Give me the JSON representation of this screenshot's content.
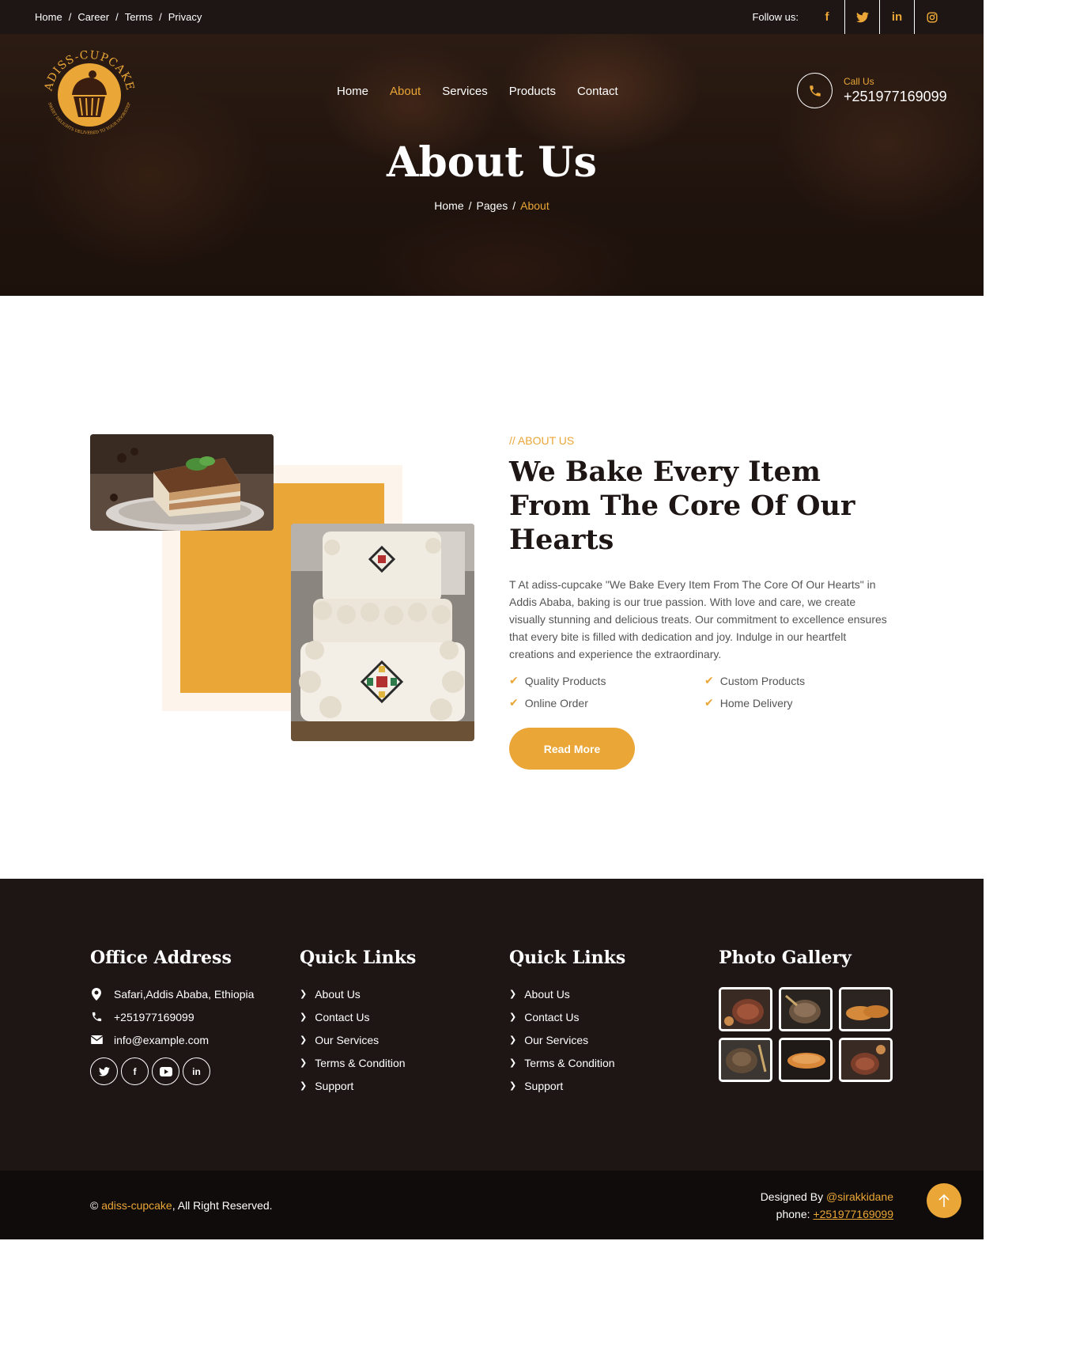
{
  "topbar": {
    "links": [
      "Home",
      "Career",
      "Terms",
      "Privacy"
    ],
    "separator": "/",
    "follow_label": "Follow us:",
    "socials": [
      "facebook-icon",
      "twitter-icon",
      "linkedin-icon",
      "instagram-icon"
    ]
  },
  "logo": {
    "brand": "ADISS-CUPCAKE",
    "tagline": "SWEET DELIGHTS DELIVERED TO YOUR DOORSTEP"
  },
  "nav": {
    "items": [
      "Home",
      "About",
      "Services",
      "Products",
      "Contact"
    ],
    "active": "About"
  },
  "call": {
    "label": "Call Us",
    "number": "+251977169099"
  },
  "hero": {
    "title": "About Us",
    "crumbs": [
      "Home",
      "Pages",
      "About"
    ]
  },
  "about": {
    "eyebrow": "// ABOUT US",
    "heading": "We Bake Every Item From The Core Of Our Hearts",
    "body": "T At adiss-cupcake \"We Bake Every Item From The Core Of Our Hearts\" in Addis Ababa, baking is our true passion. With love and care, we create visually stunning and delicious treats. Our commitment to excellence ensures that every bite is filled with dedication and joy. Indulge in our heartfelt creations and experience the extraordinary.",
    "features": [
      "Quality Products",
      "Custom Products",
      "Online Order",
      "Home Delivery"
    ],
    "button": "Read More"
  },
  "footer": {
    "office": {
      "title": "Office Address",
      "address": "Safari,Addis Ababa, Ethiopia",
      "phone": "+251977169099",
      "email": "info@example.com",
      "socials": [
        "twitter-icon",
        "facebook-icon",
        "youtube-icon",
        "linkedin-icon"
      ]
    },
    "links1": {
      "title": "Quick Links",
      "items": [
        "About Us",
        "Contact Us",
        "Our Services",
        "Terms & Condition",
        "Support"
      ]
    },
    "links2": {
      "title": "Quick Links",
      "items": [
        "About Us",
        "Contact Us",
        "Our Services",
        "Terms & Condition",
        "Support"
      ]
    },
    "gallery": {
      "title": "Photo Gallery"
    }
  },
  "bottom": {
    "copy_symbol": "©",
    "brand": "adiss-cupcake",
    "rights": ", All Right Reserved.",
    "designed_label": "Designed By",
    "designer": "@sirakkidane",
    "phone_label": "phone:",
    "phone": "+251977169099"
  },
  "colors": {
    "accent": "#eaa636",
    "dark": "#1e1614",
    "darker": "#0f0c0b"
  }
}
